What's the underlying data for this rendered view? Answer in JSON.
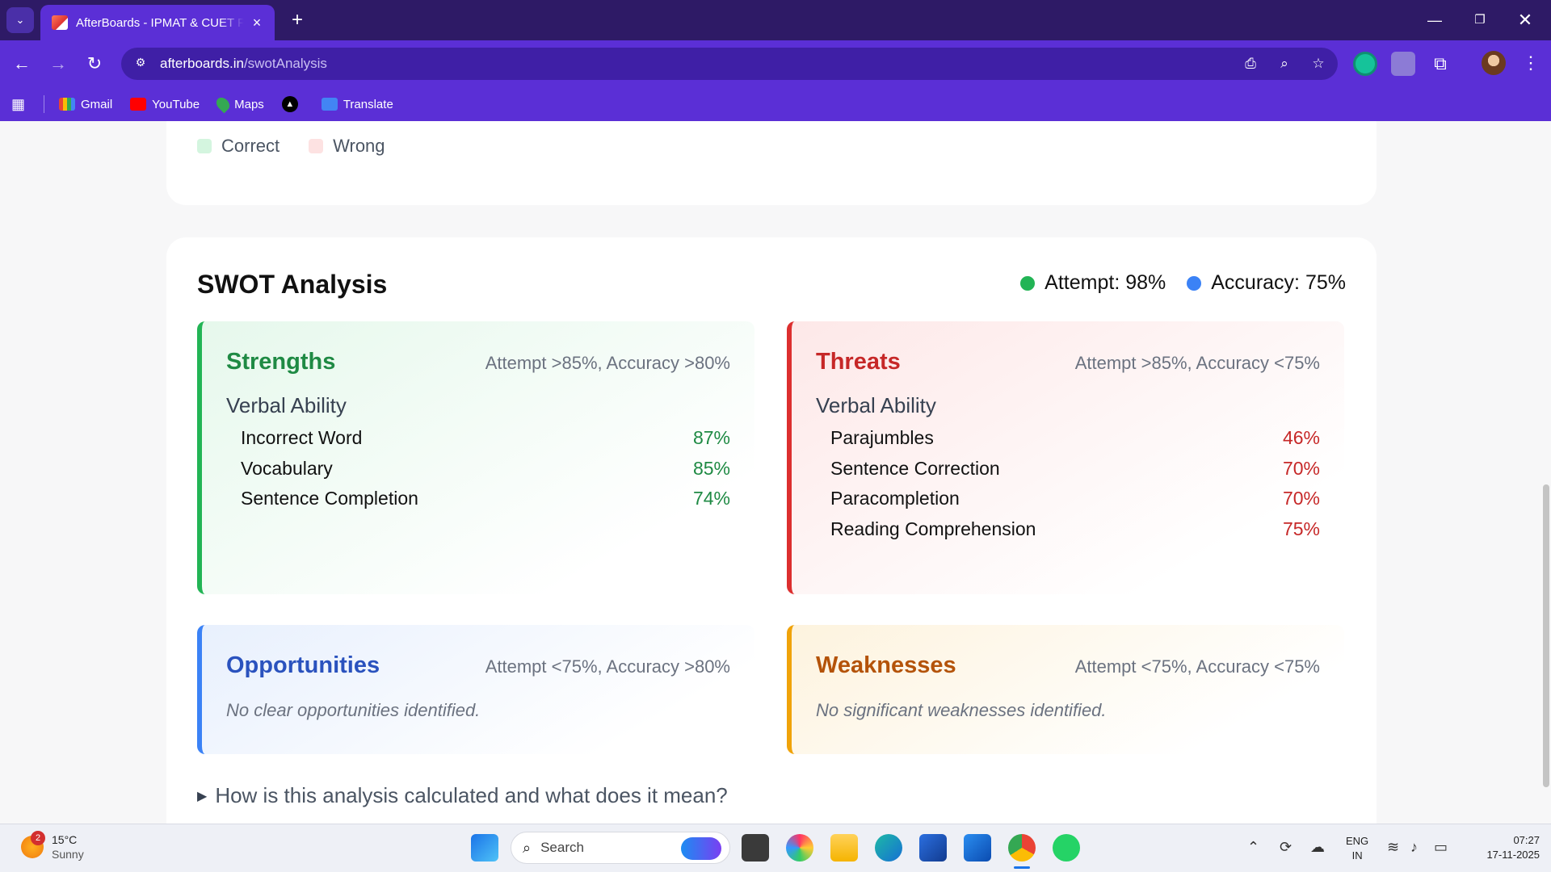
{
  "browser": {
    "tab_title": "AfterBoards - IPMAT & CUET Pr",
    "url_host": "afterboards.in",
    "url_path": "/swotAnalysis",
    "bookmarks": [
      {
        "label": "Gmail",
        "icon": "gmail-icon"
      },
      {
        "label": "YouTube",
        "icon": "youtube-icon"
      },
      {
        "label": "Maps",
        "icon": "maps-icon"
      },
      {
        "label": "",
        "icon": "app-a-icon"
      },
      {
        "label": "Translate",
        "icon": "translate-icon"
      }
    ]
  },
  "legend": {
    "correct": {
      "label": "Correct",
      "color": "#d4f5df"
    },
    "wrong": {
      "label": "Wrong",
      "color": "#fde2e2"
    }
  },
  "swot": {
    "title": "SWOT Analysis",
    "attempt": "Attempt: 98%",
    "accuracy": "Accuracy: 75%",
    "attempt_color": "#22b455",
    "accuracy_color": "#3b82f6",
    "strengths": {
      "title": "Strengths",
      "criteria": "Attempt >85%, Accuracy >80%",
      "section": "Verbal Ability",
      "items": [
        {
          "name": "Incorrect Word",
          "value": "87%"
        },
        {
          "name": "Vocabulary",
          "value": "85%"
        },
        {
          "name": "Sentence Completion",
          "value": "74%"
        }
      ]
    },
    "threats": {
      "title": "Threats",
      "criteria": "Attempt >85%, Accuracy <75%",
      "section": "Verbal Ability",
      "items": [
        {
          "name": "Parajumbles",
          "value": "46%"
        },
        {
          "name": "Sentence Correction",
          "value": "70%"
        },
        {
          "name": "Paracompletion",
          "value": "70%"
        },
        {
          "name": "Reading Comprehension",
          "value": "75%"
        }
      ]
    },
    "opportunities": {
      "title": "Opportunities",
      "criteria": "Attempt <75%, Accuracy >80%",
      "empty": "No clear opportunities identified."
    },
    "weaknesses": {
      "title": "Weaknesses",
      "criteria": "Attempt <75%, Accuracy <75%",
      "empty": "No significant weaknesses identified."
    },
    "details_summary": "How is this analysis calculated and what does it mean?"
  },
  "taskbar": {
    "weather_badge": "2",
    "temperature": "15°C",
    "condition": "Sunny",
    "search_label": "Search",
    "lang_top": "ENG",
    "lang_bottom": "IN",
    "time": "07:27",
    "date": "17-11-2025"
  }
}
